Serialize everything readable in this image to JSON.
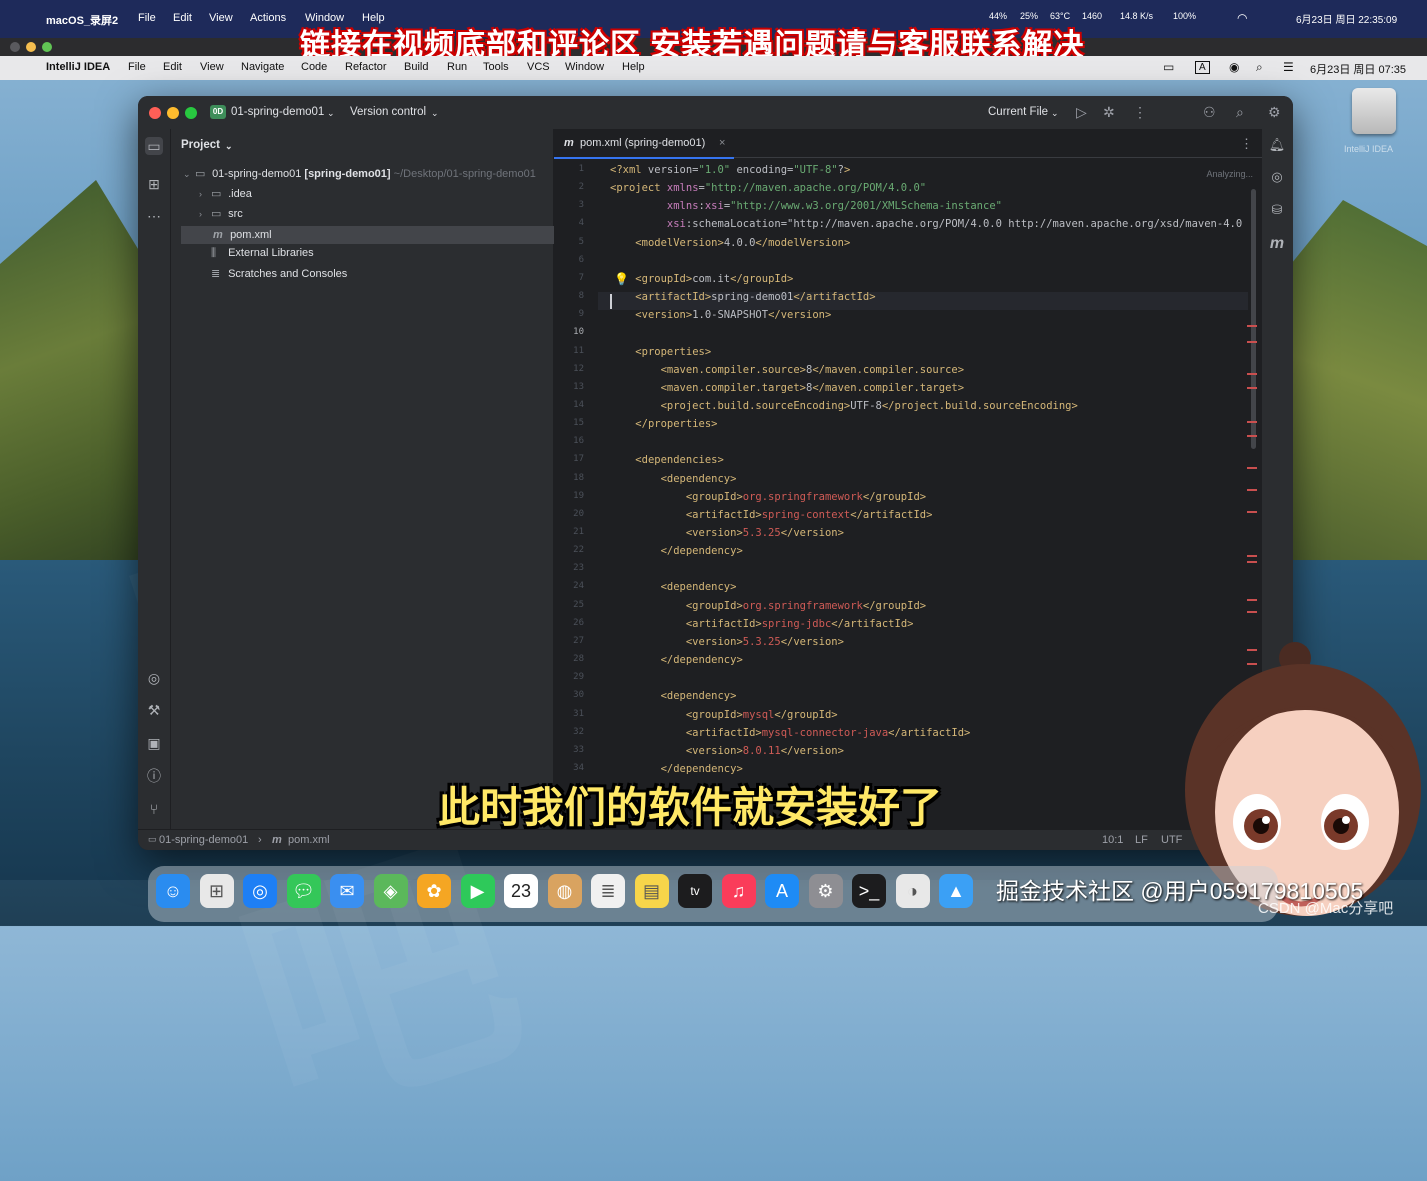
{
  "recorder": {
    "app": "macOS_录屏2",
    "menu": [
      "File",
      "Edit",
      "View",
      "Actions",
      "Window",
      "Help"
    ],
    "stats": [
      "44%",
      "25%",
      "63°C",
      "1460",
      "14.8 K/s",
      "100%"
    ],
    "datetime": "6月23日 周日 22:35:09",
    "banner": "链接在视频底部和评论区  安装若遇问题请与客服联系解决"
  },
  "menubar": {
    "app": "IntelliJ IDEA",
    "items": [
      "File",
      "Edit",
      "View",
      "Navigate",
      "Code",
      "Refactor",
      "Build",
      "Run",
      "Tools",
      "VCS",
      "Window",
      "Help"
    ],
    "ime": "A",
    "datetime": "6月23日 周日 07:35"
  },
  "desktop": {
    "drive_label": "IntelliJ IDEA"
  },
  "ide": {
    "project_badge": "0D",
    "project_name": "01-spring-demo01",
    "vcs": "Version control",
    "run_config": "Current File",
    "panel_title": "Project",
    "tree": [
      {
        "name": "01-spring-demo01",
        "module": "[spring-demo01]",
        "path": "~/Desktop/01-spring-demo01"
      },
      {
        "name": ".idea"
      },
      {
        "name": "src"
      },
      {
        "name": "pom.xml"
      },
      {
        "name": "External Libraries"
      },
      {
        "name": "Scratches and Consoles"
      }
    ],
    "tab_title": "pom.xml (spring-demo01)",
    "analyzing": "Analyzing...",
    "status": {
      "breadcrumb_project": "01-spring-demo01",
      "breadcrumb_file": "pom.xml",
      "position": "10:1",
      "line_sep": "LF",
      "encoding": "UTF"
    }
  },
  "code_lines": [
    "<?xml version=\"1.0\" encoding=\"UTF-8\"?>",
    "<project xmlns=\"http://maven.apache.org/POM/4.0.0\"",
    "         xmlns:xsi=\"http://www.w3.org/2001/XMLSchema-instance\"",
    "         xsi:schemaLocation=\"http://maven.apache.org/POM/4.0.0 http://maven.apache.org/xsd/maven-4.0",
    "    <modelVersion>4.0.0</modelVersion>",
    "",
    "    <groupId>com.it</groupId>",
    "    <artifactId>spring-demo01</artifactId>",
    "    <version>1.0-SNAPSHOT</version>",
    "",
    "    <properties>",
    "        <maven.compiler.source>8</maven.compiler.source>",
    "        <maven.compiler.target>8</maven.compiler.target>",
    "        <project.build.sourceEncoding>UTF-8</project.build.sourceEncoding>",
    "    </properties>",
    "",
    "    <dependencies>",
    "        <dependency>",
    "            <groupId>org.springframework</groupId>",
    "            <artifactId>spring-context</artifactId>",
    "            <version>5.3.25</version>",
    "        </dependency>",
    "",
    "        <dependency>",
    "            <groupId>org.springframework</groupId>",
    "            <artifactId>spring-jdbc</artifactId>",
    "            <version>5.3.25</version>",
    "        </dependency>",
    "",
    "        <dependency>",
    "            <groupId>mysql</groupId>",
    "            <artifactId>mysql-connector-java</artifactId>",
    "            <version>8.0.11</version>",
    "        </dependency>"
  ],
  "line_numbers": [
    "1",
    "2",
    "3",
    "4",
    "5",
    "6",
    "7",
    "8",
    "9",
    "10",
    "11",
    "12",
    "13",
    "14",
    "15",
    "16",
    "17",
    "18",
    "19",
    "20",
    "21",
    "22",
    "23",
    "24",
    "25",
    "26",
    "27",
    "28",
    "29",
    "30",
    "31",
    "32",
    "33",
    "34"
  ],
  "subtitle": "此时我们的软件就安装好了",
  "watermarks": {
    "juejin": "掘金技术社区 @用户059179810505",
    "csdn": "CSDN @Mac分享吧",
    "big": "Mac分享吧"
  },
  "dock_apps": [
    "finder-icon",
    "launchpad-icon",
    "safari-icon",
    "messages-icon",
    "mail-icon",
    "maps-icon",
    "photos-icon",
    "facetime-icon",
    "calendar-icon",
    "contacts-icon",
    "reminders-icon",
    "notes-icon",
    "tv-icon",
    "music-icon",
    "appstore-icon",
    "settings-icon",
    "terminal-icon",
    "preview-icon",
    "altimeter-icon"
  ],
  "calendar_day": "23",
  "tv_label": "tv"
}
